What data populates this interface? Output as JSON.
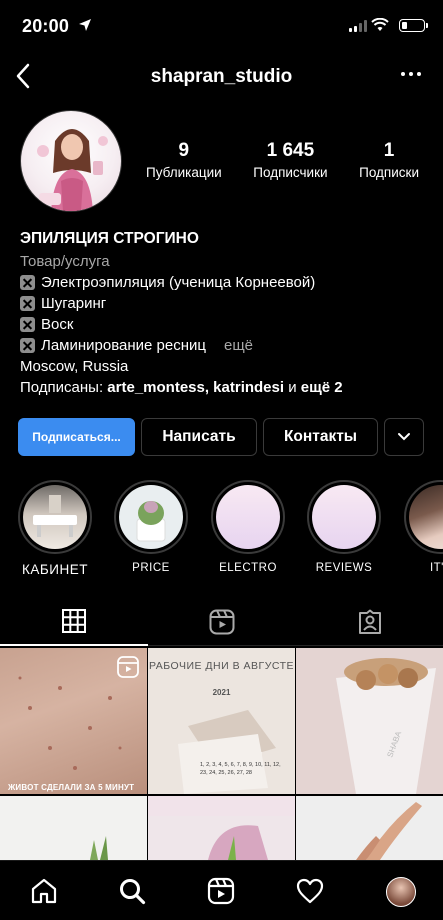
{
  "status": {
    "time": "20:00"
  },
  "header": {
    "username": "shapran_studio"
  },
  "stats": [
    {
      "num": "9",
      "label": "Публикации"
    },
    {
      "num": "1 645",
      "label": "Подписчики"
    },
    {
      "num": "1",
      "label": "Подписки"
    }
  ],
  "bio": {
    "name": "ЭПИЛЯЦИЯ СТРОГИНО",
    "category": "Товар/услуга",
    "services": [
      "Электроэпиляция (ученица Корнеевой)",
      "Шугаринг",
      "Воск",
      "Ламинирование ресниц"
    ],
    "more": "ещё",
    "location": "Moscow, Russia",
    "followed_prefix": "Подписаны:",
    "followed_names": "arte_montess, katrindesi",
    "followed_and": "и",
    "followed_more": "ещё 2"
  },
  "buttons": {
    "follow": "Подписаться...",
    "message": "Написать",
    "contacts": "Контакты"
  },
  "highlights": [
    "КАБИНЕТ",
    "PRICE",
    "ELECTRO",
    "REVIEWS",
    "IT'S"
  ],
  "grid": {
    "post1_caption": "ЖИВОТ СДЕЛАЛИ ЗА 5 МИНУТ",
    "post2_title": "РАБОЧИЕ ДНИ В АВГУСТЕ",
    "post2_year": "2021"
  },
  "icons": {
    "back": "chevron-left-icon",
    "more": "more-dots-icon",
    "grid_tab": "grid-icon",
    "reels_tab": "reels-icon",
    "tagged_tab": "tagged-icon",
    "nav": [
      "home-icon",
      "search-icon",
      "reels-icon",
      "heart-icon",
      "profile-icon"
    ]
  },
  "colors": {
    "accent": "#3b8cf0",
    "background": "#000000"
  }
}
